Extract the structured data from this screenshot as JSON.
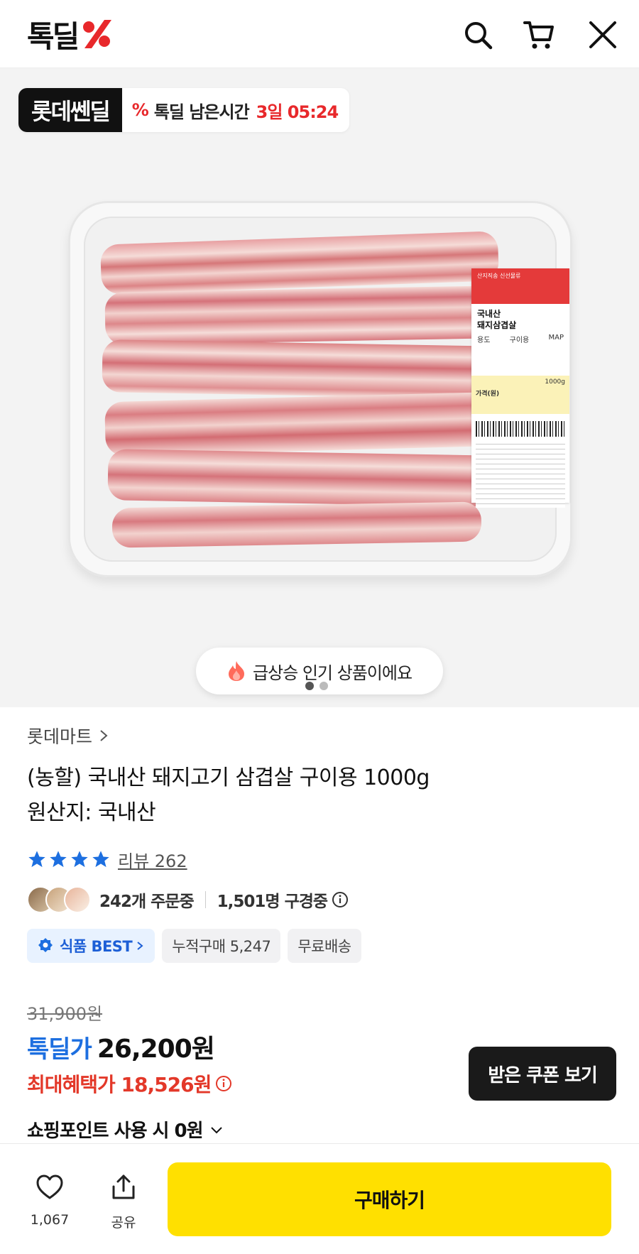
{
  "header": {
    "logo_text": "톡딜",
    "search_icon": "search-icon",
    "cart_icon": "cart-icon",
    "close_icon": "close-icon"
  },
  "hero": {
    "deal_badge_brand": "롯데쎈딜",
    "deal_badge_label": "톡딜 남은시간",
    "deal_badge_time": "3일 05:24",
    "popular_text": "급상승 인기 상품이에요",
    "label_sticker": {
      "header_text": "산지직송 신선물류",
      "name_line1": "국내산",
      "name_line2": "돼지삼겹살",
      "map": "MAP",
      "usage_label": "용도",
      "usage_value": "구이용",
      "weight": "1000g",
      "price_label": "가격(원)"
    },
    "slide_count": 2,
    "slide_active": 1
  },
  "product": {
    "seller": "롯데마트",
    "title": "(농할) 국내산 돼지고기 삼겹살 구이용 1000g",
    "origin": "원산지: 국내산",
    "rating_stars": 4,
    "review_label": "리뷰 262",
    "orders_text": "242개 주문중",
    "viewers_text": "1,501명 구경중",
    "chips": {
      "best": "식품 BEST",
      "cumulative": "누적구매 5,247",
      "shipping": "무료배송"
    }
  },
  "price": {
    "original": "31,900원",
    "deal_label": "톡딜가",
    "deal_value": "26,200원",
    "max_benefit": "최대혜택가 18,526원",
    "coupon_button": "받은 쿠폰 보기",
    "points_text": "쇼핑포인트 사용 시 0원"
  },
  "bottom_bar": {
    "like_count": "1,067",
    "share_label": "공유",
    "buy_button": "구매하기"
  },
  "colors": {
    "accent_red": "#e8282b",
    "deal_blue": "#1d6fe0",
    "buy_yellow": "#ffe000"
  }
}
